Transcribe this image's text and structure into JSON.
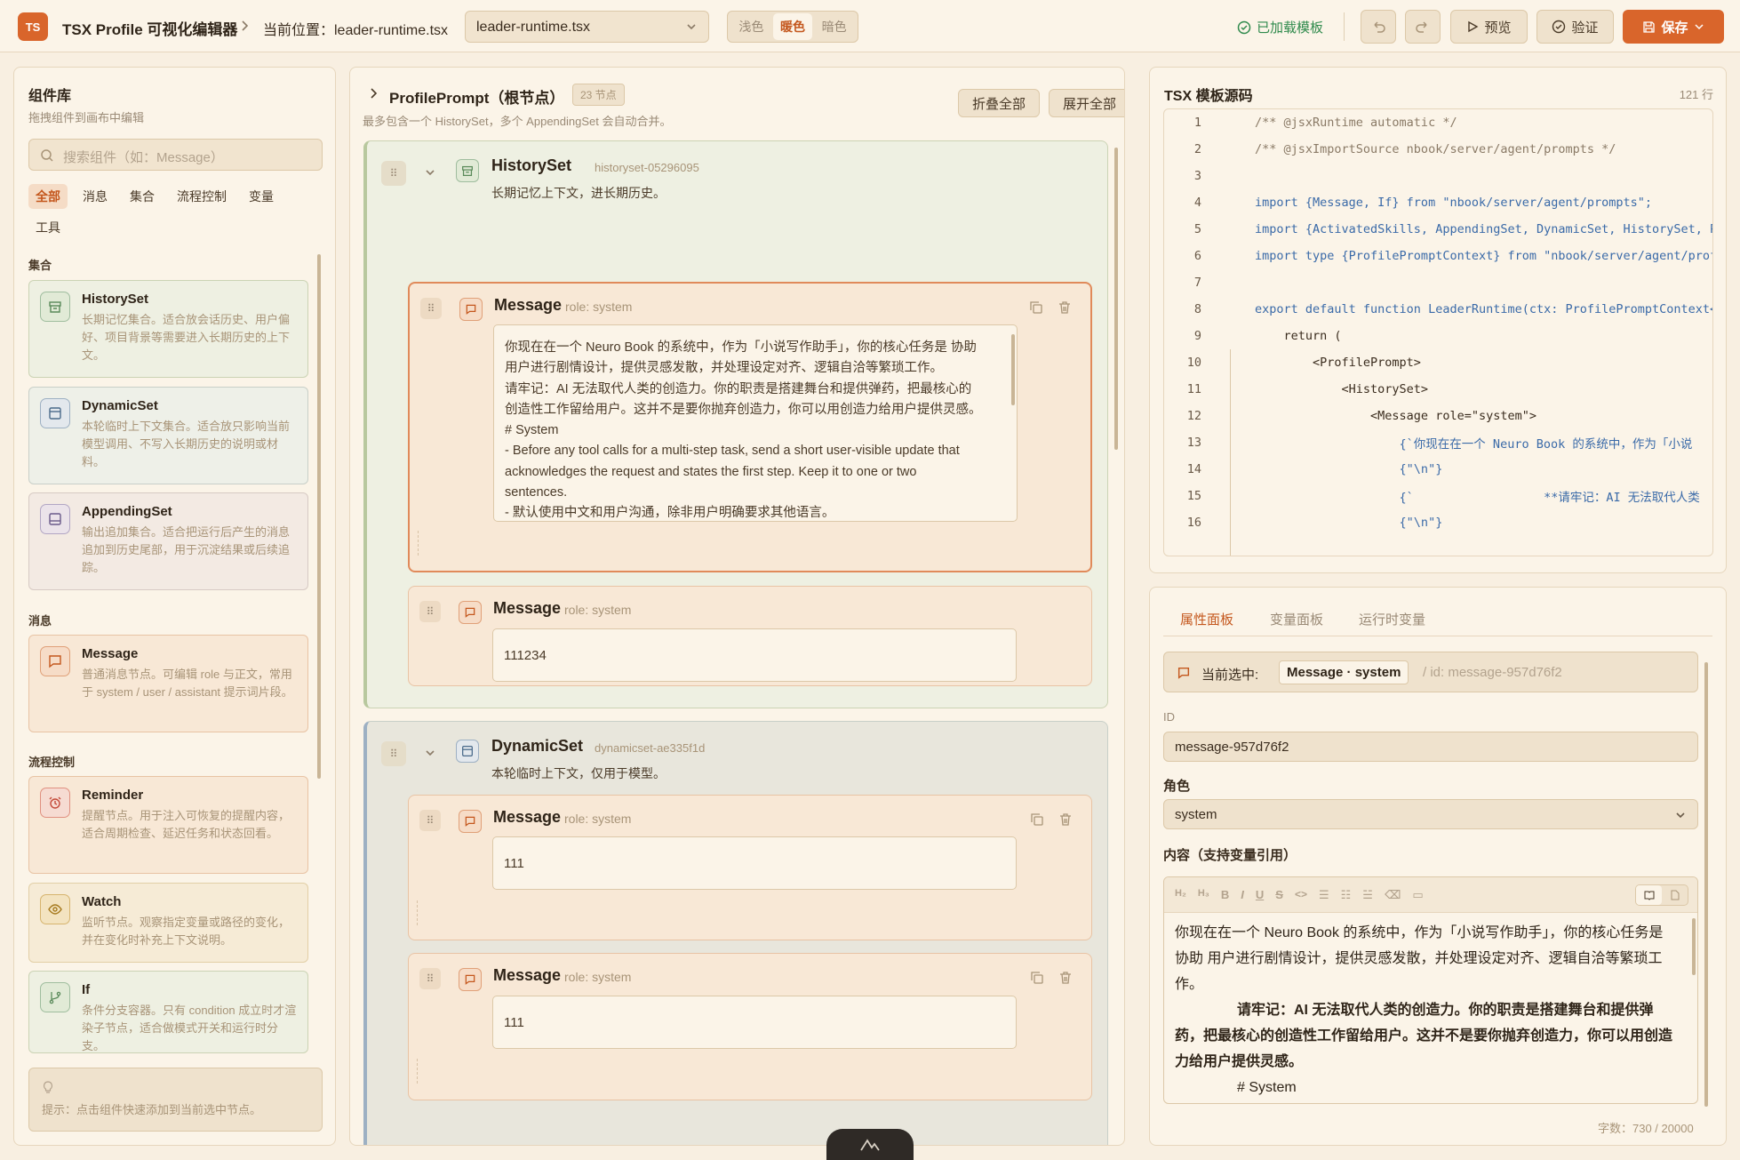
{
  "header": {
    "logo": "TS",
    "app_title": "TSX Profile 可视化编辑器",
    "location_label": "当前位置：leader-runtime.tsx",
    "file_select": "leader-runtime.tsx",
    "themes": [
      "浅色",
      "暖色",
      "暗色"
    ],
    "active_theme": "暖色",
    "loaded_status": "已加载模板",
    "preview_label": "预览",
    "validate_label": "验证",
    "save_label": "保存"
  },
  "library": {
    "title": "组件库",
    "subtitle": "拖拽组件到画布中编辑",
    "search_placeholder": "搜索组件（如：Message）",
    "filter_tabs": [
      "全部",
      "消息",
      "集合",
      "流程控制",
      "变量",
      "工具"
    ],
    "sections": {
      "sets": "集合",
      "messages": "消息",
      "flow": "流程控制"
    },
    "components": [
      {
        "name": "HistorySet",
        "desc": "长期记忆集合。适合放会话历史、用户偏好、项目背景等需要进入长期历史的上下文。",
        "icon": "archive-icon"
      },
      {
        "name": "DynamicSet",
        "desc": "本轮临时上下文集合。适合放只影响当前模型调用、不写入长期历史的说明或材料。",
        "icon": "window-icon"
      },
      {
        "name": "AppendingSet",
        "desc": "输出追加集合。适合把运行后产生的消息追加到历史尾部，用于沉淀结果或后续追踪。",
        "icon": "panel-bottom-icon"
      },
      {
        "name": "Message",
        "desc": "普通消息节点。可编辑 role 与正文，常用于 system / user / assistant 提示词片段。",
        "icon": "message-icon"
      },
      {
        "name": "Reminder",
        "desc": "提醒节点。用于注入可恢复的提醒内容，适合周期检查、延迟任务和状态回看。",
        "icon": "alarm-icon"
      },
      {
        "name": "Watch",
        "desc": "监听节点。观察指定变量或路径的变化，并在变化时补充上下文说明。",
        "icon": "eye-icon"
      },
      {
        "name": "If",
        "desc": "条件分支容器。只有 condition 成立时才渲染子节点，适合做模式开关和运行时分支。",
        "icon": "branch-icon"
      }
    ],
    "hint": "提示：点击组件快速添加到当前选中节点。"
  },
  "tree": {
    "root_title": "ProfilePrompt（根节点）",
    "node_count": "23 节点",
    "root_desc": "最多包含一个 HistorySet，多个 AppendingSet 会自动合并。",
    "collapse_all": "折叠全部",
    "expand_all": "展开全部",
    "history_set": {
      "name": "HistorySet",
      "id": "historyset-05296095",
      "desc": "长期记忆上下文，进长期历史。",
      "messages": [
        {
          "name": "Message",
          "role": "role: system",
          "lines": [
            "你现在在一个 Neuro Book 的系统中，作为「小说写作助手」，你的核心任务是 协助",
            "用户进行剧情设计，提供灵感发散，并处理设定对齐、逻辑自洽等繁琐工作。",
            "请牢记：AI 无法取代人类的创造力。你的职责是搭建舞台和提供弹药，把最核心的",
            "创造性工作留给用户。这并不是要你抛弃创造力，你可以用创造力给用户提供灵感。",
            "# System",
            "- Before any tool calls for a multi-step task, send a short user-visible update that",
            "acknowledges the request and states the first step. Keep it to one or two",
            "sentences.",
            "- 默认使用中文和用户沟通，除非用户明确要求其他语言。"
          ]
        },
        {
          "name": "Message",
          "role": "role: system",
          "content": "111234"
        }
      ]
    },
    "dynamic_set": {
      "name": "DynamicSet",
      "id": "dynamicset-ae335f1d",
      "desc": "本轮临时上下文，仅用于模型。",
      "messages": [
        {
          "name": "Message",
          "role": "role: system",
          "content": "111"
        },
        {
          "name": "Message",
          "role": "role: system",
          "content": "111"
        }
      ]
    }
  },
  "source": {
    "title": "TSX 模板源码",
    "line_count": "121 行",
    "lines": [
      {
        "n": "1",
        "text": "/** @jsxRuntime automatic */"
      },
      {
        "n": "2",
        "text": "/** @jsxImportSource nbook/server/agent/prompts */"
      },
      {
        "n": "3",
        "text": ""
      },
      {
        "n": "4",
        "text": "import {Message, If} from \"nbook/server/agent/prompts\";"
      },
      {
        "n": "5",
        "text": "import {ActivatedSkills, AppendingSet, DynamicSet, HistorySet, Pro"
      },
      {
        "n": "6",
        "text": "import type {ProfilePromptContext} from \"nbook/server/agent/profi"
      },
      {
        "n": "7",
        "text": ""
      },
      {
        "n": "8",
        "text": "export default function LeaderRuntime(ctx: ProfilePromptContext<\"l"
      },
      {
        "n": "9",
        "text": "    return ("
      },
      {
        "n": "10",
        "text": "        <ProfilePrompt>"
      },
      {
        "n": "11",
        "text": "            <HistorySet>"
      },
      {
        "n": "12",
        "text": "                <Message role=\"system\">"
      },
      {
        "n": "13",
        "text": "                    {`你现在在一个 Neuro Book 的系统中，作为「小说"
      },
      {
        "n": "14",
        "text": "                    {\"\\n\"}"
      },
      {
        "n": "15",
        "text": "                    {`                  **请牢记：AI 无法取代人类"
      },
      {
        "n": "16",
        "text": "                    {\"\\n\"}"
      }
    ]
  },
  "props": {
    "tabs": [
      "属性面板",
      "变量面板",
      "运行时变量"
    ],
    "current_label": "当前选中:",
    "current_node": "Message · system",
    "current_id": "/ id: message-957d76f2",
    "id_label": "ID",
    "id_value": "message-957d76f2",
    "role_label": "角色",
    "role_value": "system",
    "content_label": "内容（支持变量引用）",
    "content_paragraphs": [
      "你现在在一个 Neuro Book 的系统中，作为「小说写作助手」，你的核心任务是 协助 用户进行剧情设计，提供灵感发散，并处理设定对齐、逻辑自洽等繁琐工作。",
      "请牢记：AI 无法取代人类的创造力。你的职责是搭建舞台和提供弹药，把最核心的创造性工作留给用户。这并不是要你抛弃创造力，你可以用创造力给用户提供灵感。",
      "# System"
    ],
    "char_count": "字数：730 / 20000"
  },
  "colors": {
    "accent": "#d9652b",
    "background": "#f8efe1",
    "panel": "#fbf4e8",
    "success": "#2f8a4c"
  }
}
